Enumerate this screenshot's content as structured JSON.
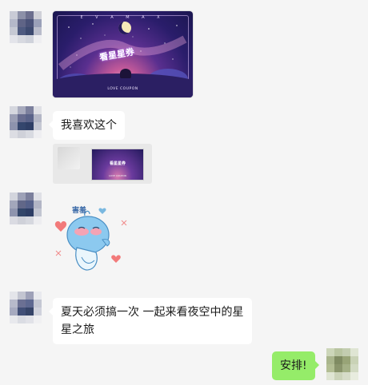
{
  "messages": [
    {
      "type": "image",
      "sender": "other",
      "image": {
        "brand": "E V A   M A X",
        "title": "看星星券",
        "label": "LOVE COUPON"
      }
    },
    {
      "type": "text",
      "sender": "other",
      "text": "我喜欢这个",
      "quote": {
        "thumb_title": "看星星券",
        "thumb_label": "LOVE COUPON"
      }
    },
    {
      "type": "sticker",
      "sender": "other",
      "sticker": {
        "caption": "害羞"
      }
    },
    {
      "type": "text",
      "sender": "other",
      "text_line1": "夏天必须搞一次 一起来看夜空中的星",
      "text_line2": "星之旅"
    },
    {
      "type": "text",
      "sender": "self",
      "text": "安排!"
    }
  ],
  "colors": {
    "background": "#f5f5f5",
    "self_bubble": "#95ec69",
    "other_bubble": "#ffffff"
  }
}
